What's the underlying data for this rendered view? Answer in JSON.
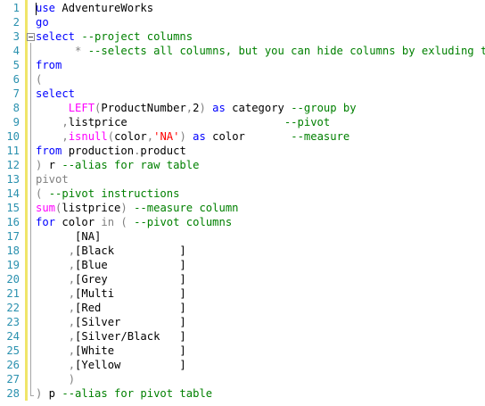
{
  "editor": {
    "lines": [
      {
        "n": "1",
        "tokens": [
          [
            "kw",
            "use"
          ],
          [
            "tx",
            " AdventureWorks"
          ]
        ]
      },
      {
        "n": "2",
        "tokens": [
          [
            "kw",
            "go"
          ]
        ]
      },
      {
        "n": "3",
        "tokens": [
          [
            "kw",
            "select"
          ],
          [
            "tx",
            " "
          ],
          [
            "cm",
            "--project columns"
          ]
        ]
      },
      {
        "n": "4",
        "tokens": [
          [
            "tx",
            "      "
          ],
          [
            "gr",
            "*"
          ],
          [
            "tx",
            " "
          ],
          [
            "cm",
            "--selects all columns, but you can hide columns by exluding them"
          ]
        ]
      },
      {
        "n": "5",
        "tokens": [
          [
            "kw",
            "from"
          ]
        ]
      },
      {
        "n": "6",
        "tokens": [
          [
            "gr",
            "("
          ]
        ]
      },
      {
        "n": "7",
        "tokens": [
          [
            "kw",
            "select"
          ]
        ]
      },
      {
        "n": "8",
        "tokens": [
          [
            "tx",
            "     "
          ],
          [
            "fn",
            "LEFT"
          ],
          [
            "gr",
            "("
          ],
          [
            "tx",
            "ProductNumber"
          ],
          [
            "gr",
            ","
          ],
          [
            "tx",
            "2"
          ],
          [
            "gr",
            ")"
          ],
          [
            "tx",
            " "
          ],
          [
            "kw",
            "as"
          ],
          [
            "tx",
            " category "
          ],
          [
            "cm",
            "--group by"
          ]
        ]
      },
      {
        "n": "9",
        "tokens": [
          [
            "tx",
            "    "
          ],
          [
            "gr",
            ","
          ],
          [
            "tx",
            "listprice                        "
          ],
          [
            "cm",
            "--pivot"
          ]
        ]
      },
      {
        "n": "10",
        "tokens": [
          [
            "tx",
            "    "
          ],
          [
            "gr",
            ","
          ],
          [
            "fn",
            "isnull"
          ],
          [
            "gr",
            "("
          ],
          [
            "tx",
            "color"
          ],
          [
            "gr",
            ","
          ],
          [
            "st",
            "'NA'"
          ],
          [
            "gr",
            ")"
          ],
          [
            "tx",
            " "
          ],
          [
            "kw",
            "as"
          ],
          [
            "tx",
            " color       "
          ],
          [
            "cm",
            "--measure"
          ]
        ]
      },
      {
        "n": "11",
        "tokens": [
          [
            "kw",
            "from"
          ],
          [
            "tx",
            " production"
          ],
          [
            "gr",
            "."
          ],
          [
            "tx",
            "product"
          ]
        ]
      },
      {
        "n": "12",
        "tokens": [
          [
            "gr",
            ")"
          ],
          [
            "tx",
            " r "
          ],
          [
            "cm",
            "--alias for raw table"
          ]
        ]
      },
      {
        "n": "13",
        "tokens": [
          [
            "gr",
            "pivot"
          ]
        ]
      },
      {
        "n": "14",
        "tokens": [
          [
            "gr",
            "("
          ],
          [
            "tx",
            " "
          ],
          [
            "cm",
            "--pivot instructions"
          ]
        ]
      },
      {
        "n": "15",
        "tokens": [
          [
            "fn",
            "sum"
          ],
          [
            "gr",
            "("
          ],
          [
            "tx",
            "listprice"
          ],
          [
            "gr",
            ")"
          ],
          [
            "tx",
            " "
          ],
          [
            "cm",
            "--measure column"
          ]
        ]
      },
      {
        "n": "16",
        "tokens": [
          [
            "kw",
            "for"
          ],
          [
            "tx",
            " color "
          ],
          [
            "gr",
            "in"
          ],
          [
            "tx",
            " "
          ],
          [
            "gr",
            "("
          ],
          [
            "tx",
            " "
          ],
          [
            "cm",
            "--pivot columns"
          ]
        ]
      },
      {
        "n": "17",
        "tokens": [
          [
            "tx",
            "      [NA]"
          ]
        ]
      },
      {
        "n": "18",
        "tokens": [
          [
            "tx",
            "     "
          ],
          [
            "gr",
            ","
          ],
          [
            "tx",
            "[Black          ]"
          ]
        ]
      },
      {
        "n": "19",
        "tokens": [
          [
            "tx",
            "     "
          ],
          [
            "gr",
            ","
          ],
          [
            "tx",
            "[Blue           ]"
          ]
        ]
      },
      {
        "n": "20",
        "tokens": [
          [
            "tx",
            "     "
          ],
          [
            "gr",
            ","
          ],
          [
            "tx",
            "[Grey           ]"
          ]
        ]
      },
      {
        "n": "21",
        "tokens": [
          [
            "tx",
            "     "
          ],
          [
            "gr",
            ","
          ],
          [
            "tx",
            "[Multi          ]"
          ]
        ]
      },
      {
        "n": "22",
        "tokens": [
          [
            "tx",
            "     "
          ],
          [
            "gr",
            ","
          ],
          [
            "tx",
            "[Red            ]"
          ]
        ]
      },
      {
        "n": "23",
        "tokens": [
          [
            "tx",
            "     "
          ],
          [
            "gr",
            ","
          ],
          [
            "tx",
            "[Silver         ]"
          ]
        ]
      },
      {
        "n": "24",
        "tokens": [
          [
            "tx",
            "     "
          ],
          [
            "gr",
            ","
          ],
          [
            "tx",
            "[Silver/Black   ]"
          ]
        ]
      },
      {
        "n": "25",
        "tokens": [
          [
            "tx",
            "     "
          ],
          [
            "gr",
            ","
          ],
          [
            "tx",
            "[White          ]"
          ]
        ]
      },
      {
        "n": "26",
        "tokens": [
          [
            "tx",
            "     "
          ],
          [
            "gr",
            ","
          ],
          [
            "tx",
            "[Yellow         ]"
          ]
        ]
      },
      {
        "n": "27",
        "tokens": [
          [
            "tx",
            "     "
          ],
          [
            "gr",
            ")"
          ]
        ]
      },
      {
        "n": "28",
        "tokens": [
          [
            "gr",
            ")"
          ],
          [
            "tx",
            " p "
          ],
          [
            "cm",
            "--alias for pivot table"
          ]
        ]
      }
    ],
    "colors": {
      "keyword": "#0000ff",
      "comment": "#008000",
      "function": "#ff00ff",
      "operator": "#808080",
      "string": "#ff0000",
      "line_number": "#2b91af",
      "change_bar": "#f0e56a"
    }
  }
}
